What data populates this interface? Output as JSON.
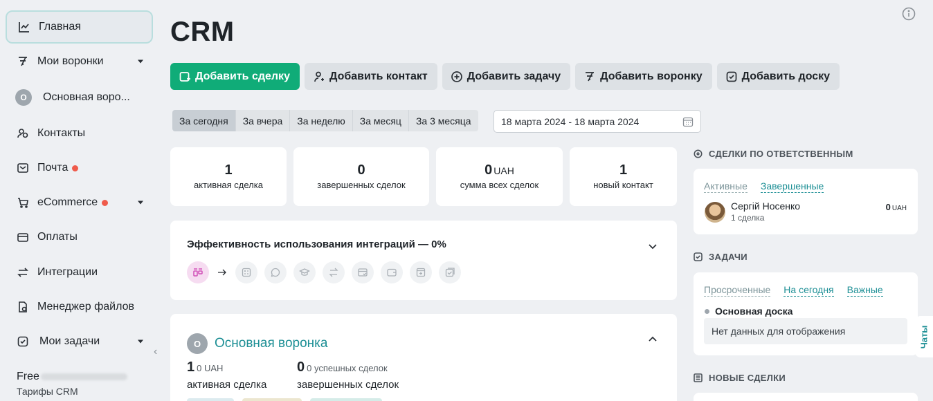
{
  "sidebar": {
    "items": [
      {
        "label": "Главная",
        "icon": "chart-line-icon",
        "active": true
      },
      {
        "label": "Мои воронки",
        "icon": "funnel-icon",
        "dropdown": true
      },
      {
        "label": "Основная воро...",
        "icon": "circle-o-avatar",
        "avatar_letter": "O"
      },
      {
        "label": "Контакты",
        "icon": "contacts-icon"
      },
      {
        "label": "Почта",
        "icon": "mail-icon",
        "badge": true
      },
      {
        "label": "eCommerce",
        "icon": "cart-icon",
        "badge": true,
        "dropdown": true
      },
      {
        "label": "Оплаты",
        "icon": "wallet-icon"
      },
      {
        "label": "Интеграции",
        "icon": "swap-icon"
      },
      {
        "label": "Менеджер файлов",
        "icon": "file-icon"
      },
      {
        "label": "Мои задачи",
        "icon": "task-check-icon",
        "dropdown": true
      }
    ],
    "plan": "Free",
    "plan_link": "Тарифы CRM"
  },
  "page_title": "CRM",
  "toolbar": {
    "add_deal": "Добавить сделку",
    "add_contact": "Добавить контакт",
    "add_task": "Добавить задачу",
    "add_funnel": "Добавить воронку",
    "add_board": "Добавить доску"
  },
  "periods": [
    "За сегодня",
    "За вчера",
    "За неделю",
    "За месяц",
    "За 3 месяца"
  ],
  "active_period": 0,
  "date_range": "18 марта 2024 - 18 марта 2024",
  "stats": [
    {
      "value": "1",
      "unit": "",
      "label": "активная сделка"
    },
    {
      "value": "0",
      "unit": "",
      "label": "завершенных сделок"
    },
    {
      "value": "0",
      "unit": "UAH",
      "label": "сумма всех сделок"
    },
    {
      "value": "1",
      "unit": "",
      "label": "новый контакт"
    }
  ],
  "efficiency": {
    "title": "Эффективность использования интеграций — 0%",
    "integration_icons": [
      "funnel-board-icon",
      "calculator-icon",
      "chat-bubble-icon",
      "graduation-cap-icon",
      "swap-arrows-icon",
      "receipt-icon",
      "wallet-card-icon",
      "add-doc-icon",
      "checklist-icon"
    ]
  },
  "funnel": {
    "avatar_letter": "O",
    "name": "Основная воронка",
    "active_count": "1",
    "active_amount": "0 UAH",
    "active_label": "активная сделка",
    "done_count": "0",
    "done_sub": "0 успешных сделок",
    "done_label": "завершенных сделок"
  },
  "deals_by_owner": {
    "heading": "СДЕЛКИ ПО ОТВЕТСТВЕННЫМ",
    "tab_active": "Активные",
    "tab_done": "Завершенные",
    "person_name": "Сергій Носенко",
    "person_sub": "1 сделка",
    "person_value": "0",
    "person_unit": "UAH"
  },
  "tasks": {
    "heading": "ЗАДАЧИ",
    "tabs": [
      "Просроченные",
      "На сегодня",
      "Важные"
    ],
    "board_name": "Основная доска",
    "empty_text": "Нет данных для отображения"
  },
  "new_deals": {
    "heading": "НОВЫЕ СДЕЛКИ"
  },
  "chat_tab": "Чаты",
  "colors": {
    "accent": "#10ac78",
    "link": "#1d8f95",
    "badge": "#ef5b4b"
  }
}
